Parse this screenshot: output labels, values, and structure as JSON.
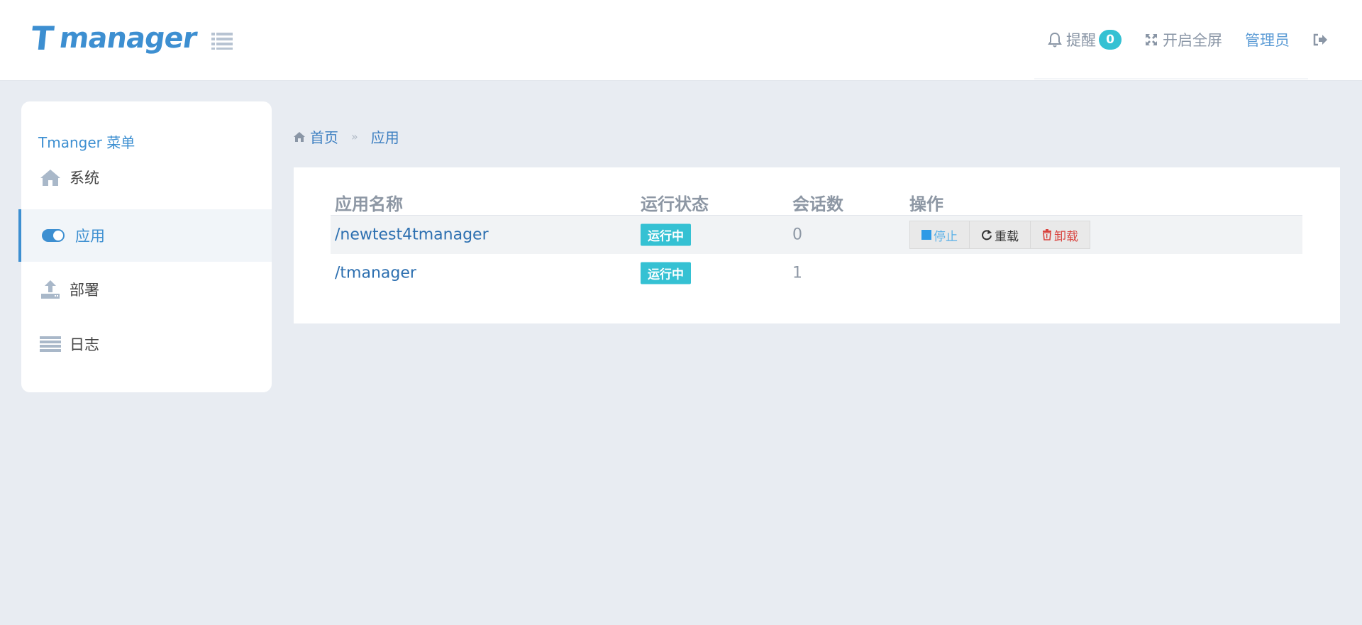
{
  "header": {
    "logo_t": "T",
    "logo_rest": "manager",
    "notify_label": "提醒",
    "notify_count": "0",
    "fullscreen_label": "开启全屏",
    "admin_label": "管理员"
  },
  "sidebar": {
    "title": "Tmanger 菜单",
    "items": [
      {
        "label": "系统",
        "icon": "home-icon"
      },
      {
        "label": "应用",
        "icon": "toggle-icon",
        "active": true
      },
      {
        "label": "部署",
        "icon": "upload-icon"
      },
      {
        "label": "日志",
        "icon": "list-icon"
      }
    ]
  },
  "breadcrumb": {
    "home": "首页",
    "separator": "»",
    "current": "应用"
  },
  "table": {
    "headers": [
      "应用名称",
      "运行状态",
      "会话数",
      "操作"
    ],
    "rows": [
      {
        "name": "/newtest4tmanager",
        "status": "运行中",
        "sessions": "0",
        "actions": [
          "停止",
          "重载",
          "卸载"
        ]
      },
      {
        "name": "/tmanager",
        "status": "运行中",
        "sessions": "1"
      }
    ]
  },
  "colors": {
    "brand": "#3d8fd1",
    "badge": "#35c1d3",
    "danger": "#d9443f",
    "background": "#e8ecf2"
  }
}
